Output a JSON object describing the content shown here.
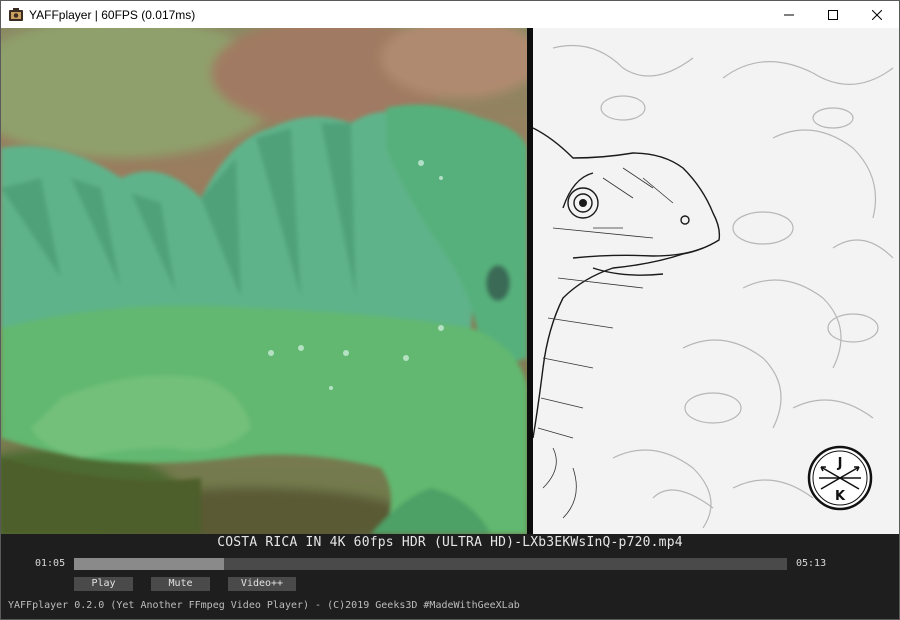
{
  "window": {
    "title": "YAFFplayer | 60FPS (0.017ms)",
    "controls": [
      "minimize-icon",
      "maximize-icon",
      "close-icon"
    ]
  },
  "video": {
    "badge_letters": [
      "J",
      "K"
    ]
  },
  "player": {
    "file_title": "COSTA RICA IN 4K 60fps HDR (ULTRA HD)-LXb3EKWsInQ-p720.mp4",
    "current_time": "01:05",
    "total_time": "05:13",
    "progress": 0.21,
    "buttons": {
      "play": "Play",
      "mute": "Mute",
      "video": "Video++"
    },
    "footer": "YAFFplayer 0.2.0 (Yet Another FFmpeg Video Player) - (C)2019 Geeks3D #MadeWithGeeXLab"
  },
  "colors": {
    "panel_bg": "#1e1e1e",
    "progress_track": "#4a4a4a",
    "progress_fill": "#8a8a8a",
    "button_bg": "#4a4a4a"
  }
}
